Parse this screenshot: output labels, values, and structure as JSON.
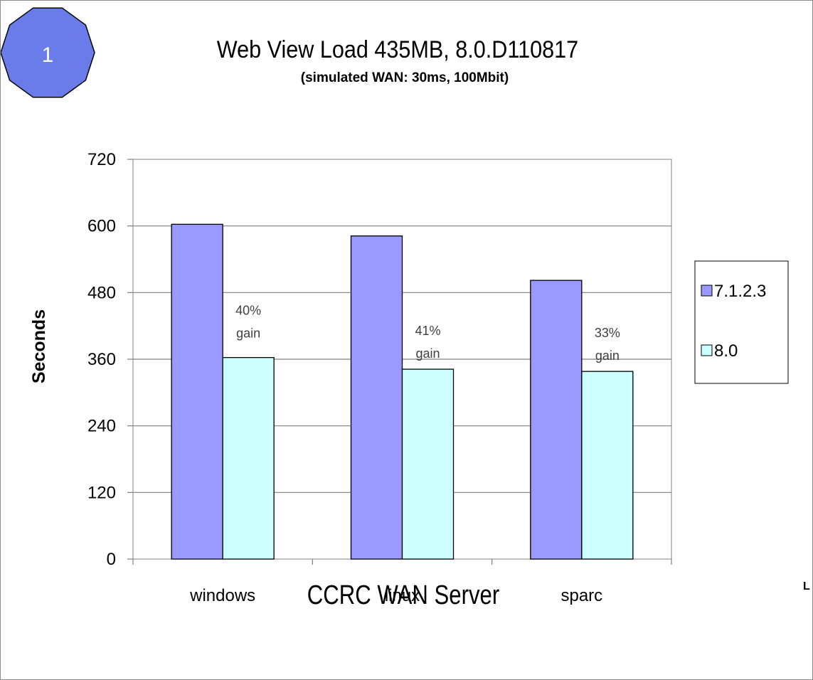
{
  "badge": {
    "label": "1",
    "color": "#6a7bea"
  },
  "chart_data": {
    "type": "bar",
    "title": "Web View Load 435MB, 8.0.D110817",
    "subtitle": "(simulated WAN: 30ms, 100Mbit)",
    "xlabel": "CCRC WAN Server",
    "ylabel": "Seconds",
    "categories": [
      "windows",
      "linux",
      "sparc"
    ],
    "series": [
      {
        "name": "7.1.2.3",
        "color": "#9999ff",
        "values": [
          603,
          582,
          502
        ]
      },
      {
        "name": "8.0",
        "color": "#ccffff",
        "values": [
          363,
          342,
          338
        ]
      }
    ],
    "annotations": [
      {
        "category": "windows",
        "lines": [
          "40%",
          "gain"
        ]
      },
      {
        "category": "linux",
        "lines": [
          "41%",
          "gain"
        ]
      },
      {
        "category": "sparc",
        "lines": [
          "33%",
          "gain"
        ]
      }
    ],
    "ylim": [
      0,
      720
    ],
    "yticks": [
      0,
      120,
      240,
      360,
      480,
      600,
      720
    ],
    "grid": true,
    "legend_position": "right"
  },
  "stray_text": "L"
}
